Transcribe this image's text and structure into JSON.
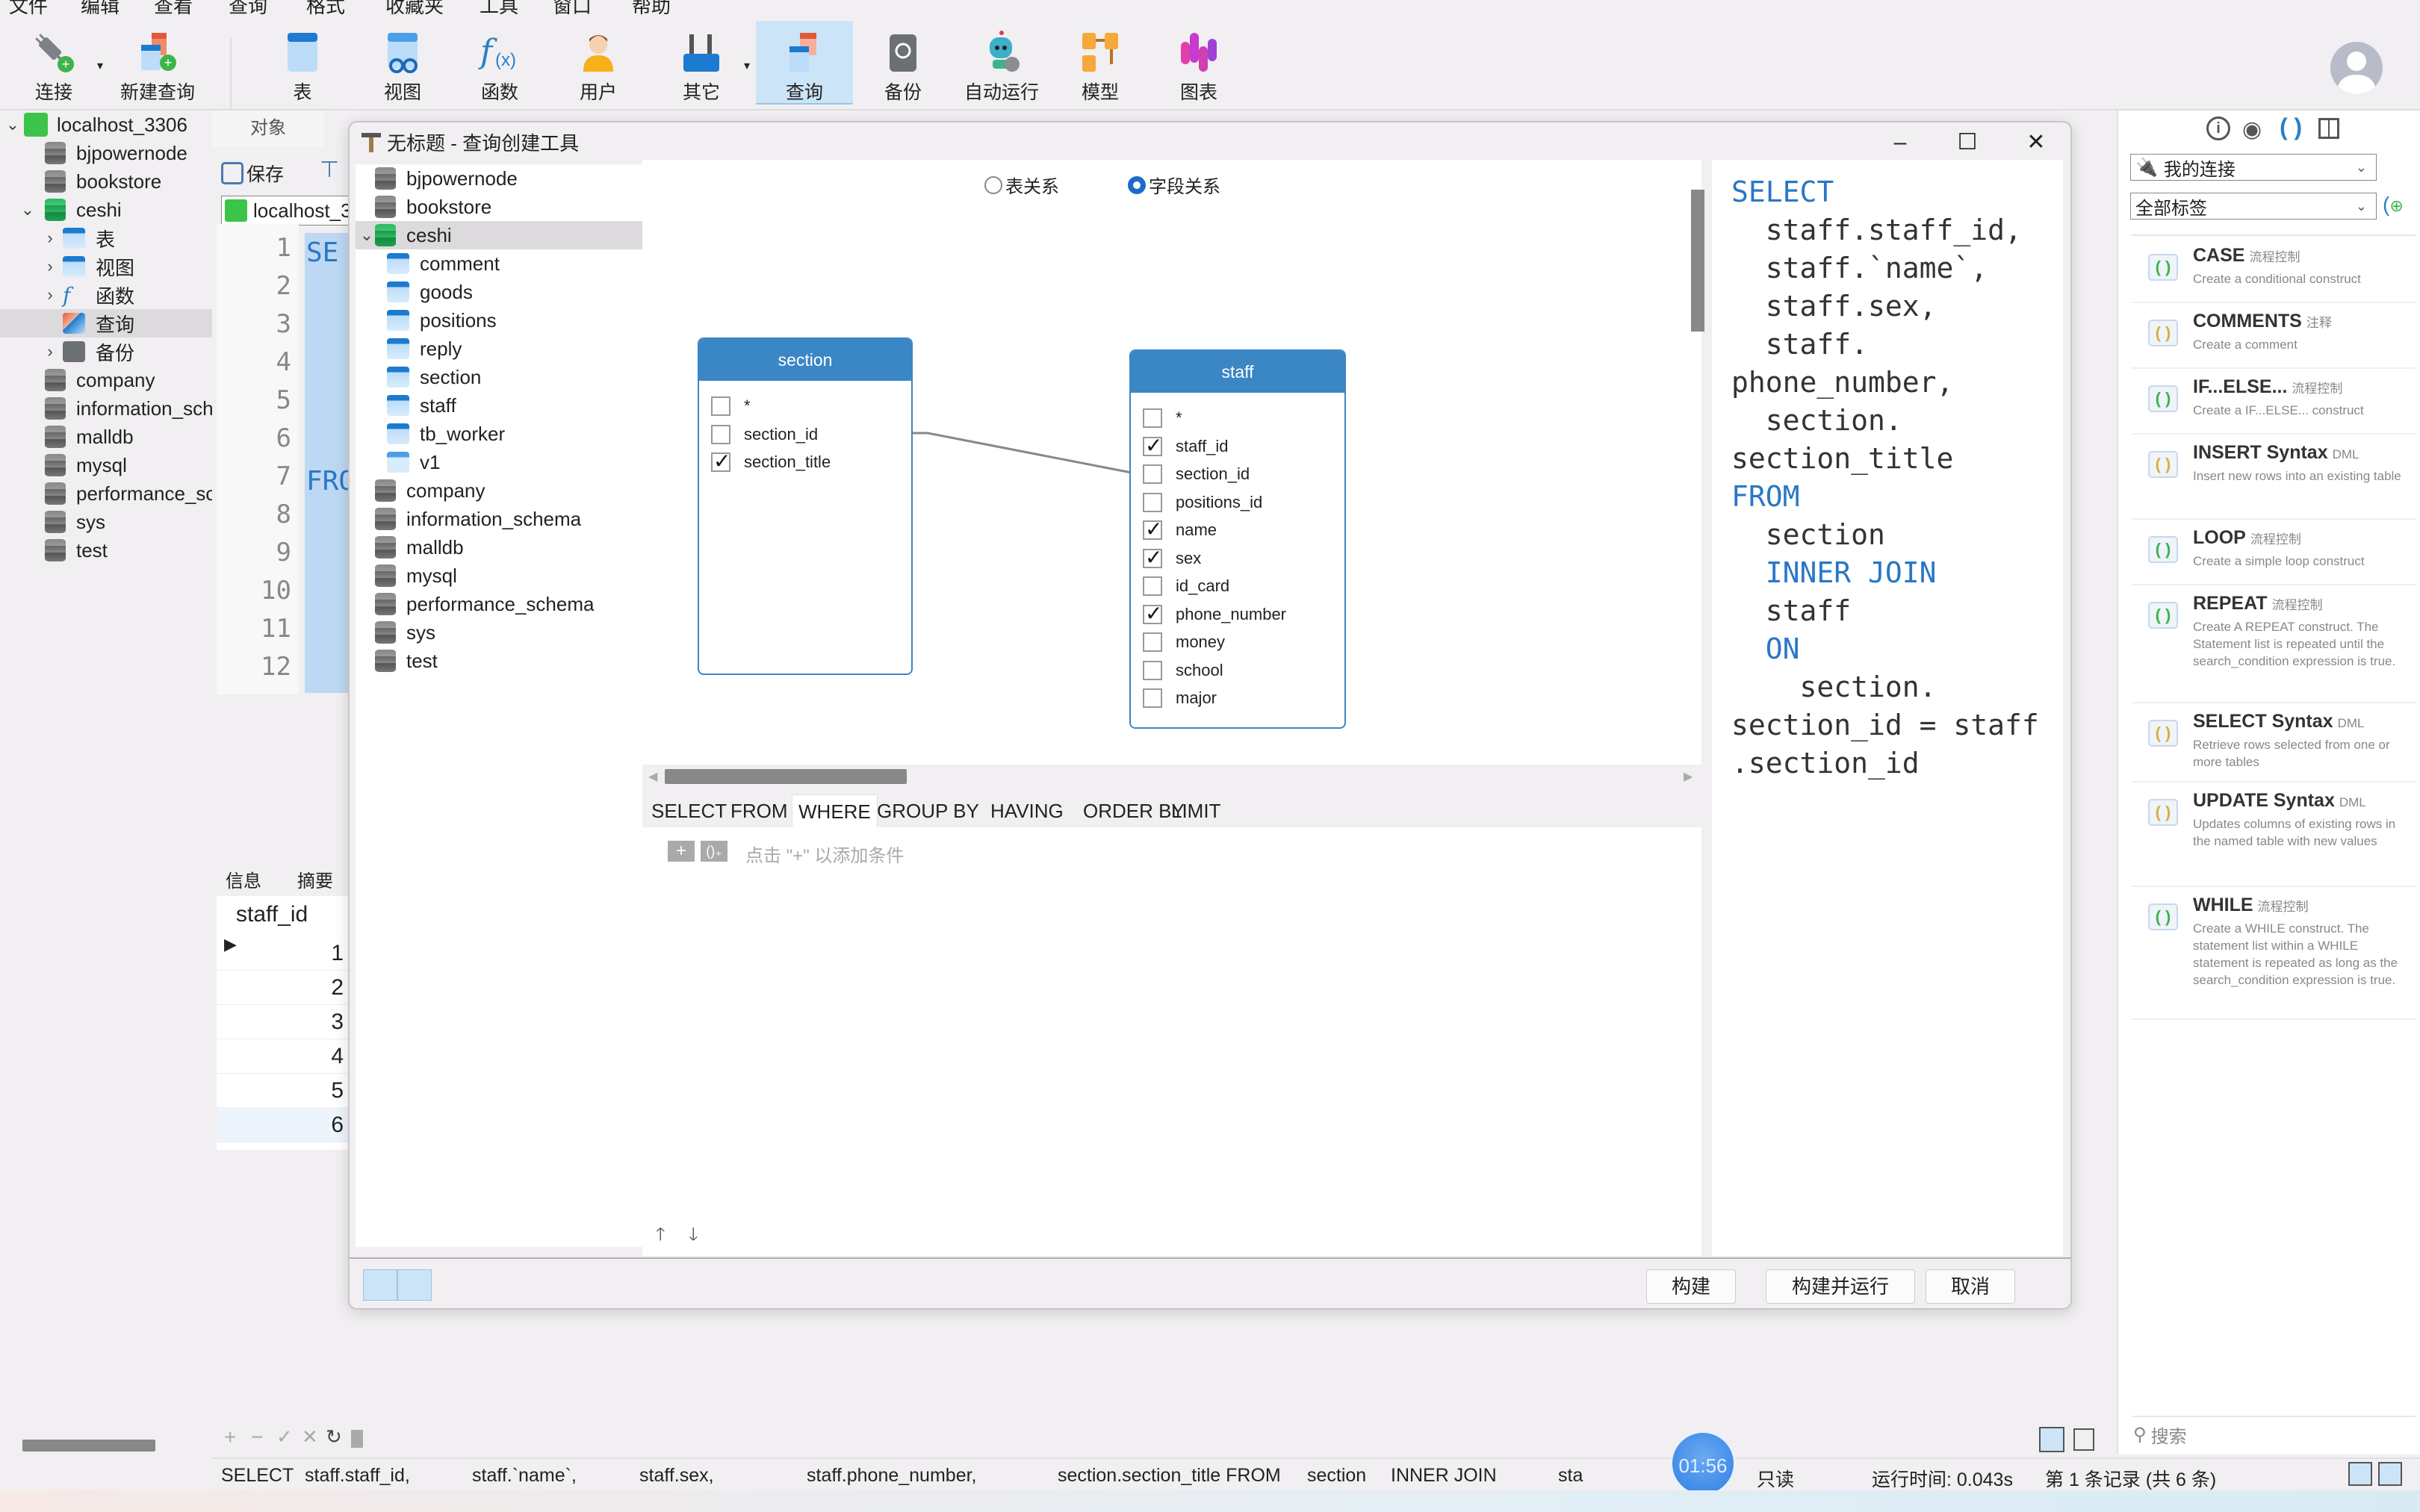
{
  "menu": [
    "文件",
    "编辑",
    "查看",
    "查询",
    "格式",
    "收藏夹",
    "工具",
    "窗口",
    "帮助"
  ],
  "toolbar": {
    "items": [
      {
        "label": "连接",
        "icon": "plug-connect-icon"
      },
      {
        "label": "新建查询",
        "icon": "new-query-icon"
      },
      {
        "label": "表",
        "icon": "table-icon"
      },
      {
        "label": "视图",
        "icon": "view-icon"
      },
      {
        "label": "函数",
        "icon": "function-icon"
      },
      {
        "label": "用户",
        "icon": "user-icon"
      },
      {
        "label": "其它",
        "icon": "tools-icon"
      },
      {
        "label": "查询",
        "icon": "query-icon",
        "active": true
      },
      {
        "label": "备份",
        "icon": "backup-icon"
      },
      {
        "label": "自动运行",
        "icon": "robot-icon"
      },
      {
        "label": "模型",
        "icon": "model-icon"
      },
      {
        "label": "图表",
        "icon": "chart-icon"
      }
    ]
  },
  "nav": {
    "connection": "localhost_3306",
    "items": [
      {
        "label": "bjpowernode",
        "type": "db"
      },
      {
        "label": "bookstore",
        "type": "db"
      },
      {
        "label": "ceshi",
        "type": "db-open"
      },
      {
        "label": "表",
        "type": "folder-table"
      },
      {
        "label": "视图",
        "type": "folder-view"
      },
      {
        "label": "函数",
        "type": "folder-function"
      },
      {
        "label": "查询",
        "type": "folder-query",
        "selected": true
      },
      {
        "label": "备份",
        "type": "folder-backup"
      },
      {
        "label": "company",
        "type": "db"
      },
      {
        "label": "information_sch",
        "type": "db"
      },
      {
        "label": "malldb",
        "type": "db"
      },
      {
        "label": "mysql",
        "type": "db"
      },
      {
        "label": "performance_scl",
        "type": "db"
      },
      {
        "label": "sys",
        "type": "db"
      },
      {
        "label": "test",
        "type": "db"
      }
    ]
  },
  "editor": {
    "object_tab": "对象",
    "save_label": "保存",
    "connection_combo": "localhost_3",
    "line_numbers": [
      "1",
      "2",
      "3",
      "4",
      "5",
      "6",
      "7",
      "8",
      "9",
      "10",
      "11",
      "12"
    ],
    "visible_code": {
      "1": "SE",
      "7": "FRO"
    }
  },
  "results": {
    "tabs": [
      "信息",
      "摘要"
    ],
    "column": "staff_id",
    "rows": [
      "1",
      "2",
      "3",
      "4",
      "5",
      "6"
    ]
  },
  "dialog": {
    "title": "无标题 - 查询创建工具",
    "tree": [
      {
        "label": "bjpowernode",
        "type": "db"
      },
      {
        "label": "bookstore",
        "type": "db"
      },
      {
        "label": "ceshi",
        "type": "db-open",
        "selected": true
      },
      {
        "label": "comment",
        "type": "table"
      },
      {
        "label": "goods",
        "type": "table"
      },
      {
        "label": "positions",
        "type": "table"
      },
      {
        "label": "reply",
        "type": "table"
      },
      {
        "label": "section",
        "type": "table"
      },
      {
        "label": "staff",
        "type": "table"
      },
      {
        "label": "tb_worker",
        "type": "table"
      },
      {
        "label": "v1",
        "type": "view"
      },
      {
        "label": "company",
        "type": "db"
      },
      {
        "label": "information_schema",
        "type": "db"
      },
      {
        "label": "malldb",
        "type": "db"
      },
      {
        "label": "mysql",
        "type": "db"
      },
      {
        "label": "performance_schema",
        "type": "db"
      },
      {
        "label": "sys",
        "type": "db"
      },
      {
        "label": "test",
        "type": "db"
      }
    ],
    "relation_mode": {
      "options": [
        "表关系",
        "字段关系"
      ],
      "selected": "字段关系"
    },
    "tables": [
      {
        "name": "section",
        "fields": [
          {
            "name": "*",
            "checked": false
          },
          {
            "name": "section_id",
            "checked": false
          },
          {
            "name": "section_title",
            "checked": true
          }
        ]
      },
      {
        "name": "staff",
        "fields": [
          {
            "name": "*",
            "checked": false
          },
          {
            "name": "staff_id",
            "checked": true
          },
          {
            "name": "section_id",
            "checked": false
          },
          {
            "name": "positions_id",
            "checked": false
          },
          {
            "name": "name",
            "checked": true
          },
          {
            "name": "sex",
            "checked": true
          },
          {
            "name": "id_card",
            "checked": false
          },
          {
            "name": "phone_number",
            "checked": true
          },
          {
            "name": "money",
            "checked": false
          },
          {
            "name": "school",
            "checked": false
          },
          {
            "name": "major",
            "checked": false
          }
        ]
      }
    ],
    "join": {
      "from": "section.section_id",
      "to": "staff.section_id"
    },
    "clause_tabs": [
      "SELECT",
      "FROM",
      "WHERE",
      "GROUP BY",
      "HAVING",
      "ORDER BY",
      "LIMIT"
    ],
    "active_clause": "WHERE",
    "where_hint": "点击 \"+\" 以添加条件",
    "sql_lines": [
      {
        "t": "SELECT",
        "kw": true
      },
      {
        "t": "  staff.staff_id,"
      },
      {
        "t": "  staff.`name`,"
      },
      {
        "t": "  staff.sex,"
      },
      {
        "t": "  staff."
      },
      {
        "t": "phone_number,"
      },
      {
        "t": "  section."
      },
      {
        "t": "section_title"
      },
      {
        "t": "FROM",
        "kw": true
      },
      {
        "t": "  section"
      },
      {
        "t": "  INNER JOIN",
        "kw": true
      },
      {
        "t": "  staff"
      },
      {
        "t": "  ON",
        "kw": true
      },
      {
        "t": "    section."
      },
      {
        "t": "section_id = staff"
      },
      {
        "t": ".section_id"
      }
    ],
    "buttons": {
      "build": "构建",
      "build_run": "构建并运行",
      "cancel": "取消"
    }
  },
  "right_panel": {
    "connection_combo": "我的连接",
    "tag_combo": "全部标签",
    "snippets": [
      {
        "title": "CASE",
        "tag": "流程控制",
        "desc": "Create a conditional construct",
        "color": "green"
      },
      {
        "title": "COMMENTS",
        "tag": "注释",
        "desc": "Create a comment",
        "color": "yellow"
      },
      {
        "title": "IF...ELSE...",
        "tag": "流程控制",
        "desc": "Create a IF...ELSE... construct",
        "color": "green"
      },
      {
        "title": "INSERT Syntax",
        "tag": "DML",
        "desc": "Insert new rows into an existing table",
        "color": "yellow"
      },
      {
        "title": "LOOP",
        "tag": "流程控制",
        "desc": "Create a simple loop construct",
        "color": "green"
      },
      {
        "title": "REPEAT",
        "tag": "流程控制",
        "desc": "Create A REPEAT construct. The Statement list is repeated until the search_condition expression is true.",
        "color": "green"
      },
      {
        "title": "SELECT Syntax",
        "tag": "DML",
        "desc": "Retrieve rows selected from one or more tables",
        "color": "yellow"
      },
      {
        "title": "UPDATE Syntax",
        "tag": "DML",
        "desc": "Updates columns of existing rows in the named table with new values",
        "color": "yellow"
      },
      {
        "title": "WHILE",
        "tag": "流程控制",
        "desc": "Create a WHILE construct. The statement list within a WHILE statement is repeated as long as the search_condition expression is true.",
        "color": "green"
      }
    ],
    "search_placeholder": "搜索"
  },
  "status": {
    "sql_preview": [
      "SELECT",
      "staff.staff_id,",
      "staff.`name`,",
      "staff.sex,",
      "staff.phone_number,",
      "section.section_title FROM",
      "section",
      "INNER JOIN",
      "sta"
    ],
    "timer": "01:56",
    "readonly": "只读",
    "runtime": "运行时间: 0.043s",
    "record": "第 1 条记录 (共 6 条)"
  },
  "colors": {
    "accent": "#3b86c4",
    "keyword": "#2a77c6",
    "active_bg": "#cce4f7"
  }
}
